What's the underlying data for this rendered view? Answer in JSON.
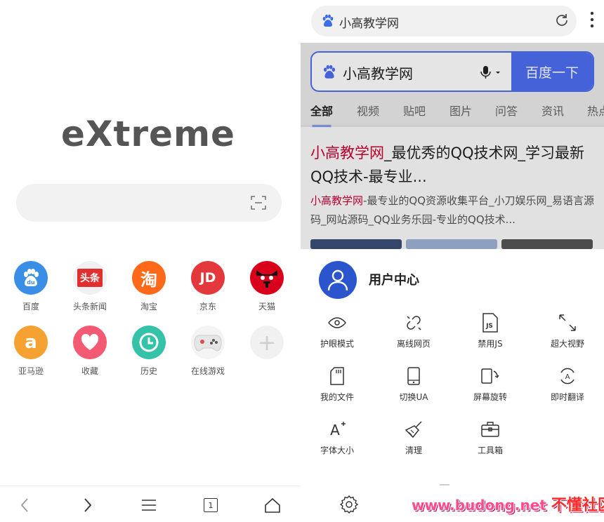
{
  "home": {
    "logo": "eXtreme",
    "shortcuts": [
      {
        "label": "百度",
        "icon": "baidu-paw-icon",
        "glyph": "",
        "color": "#3b8ee5"
      },
      {
        "label": "头条新闻",
        "icon": "toutiao-icon",
        "glyph": "头条",
        "color": "#f0f0f0"
      },
      {
        "label": "淘宝",
        "icon": "taobao-icon",
        "glyph": "淘",
        "color": "#ff6a1a"
      },
      {
        "label": "京东",
        "icon": "jd-icon",
        "glyph": "JD",
        "color": "#e4393c"
      },
      {
        "label": "天猫",
        "icon": "tmall-icon",
        "glyph": "",
        "color": "#d8001b"
      },
      {
        "label": "亚马逊",
        "icon": "amazon-icon",
        "glyph": "a",
        "color": "#f5a233"
      },
      {
        "label": "收藏",
        "icon": "heart-icon",
        "glyph": "",
        "color": "#f25b73"
      },
      {
        "label": "历史",
        "icon": "clock-icon",
        "glyph": "",
        "color": "#34c3a8"
      },
      {
        "label": "在线游戏",
        "icon": "gamepad-icon",
        "glyph": "",
        "color": "#f2f2f2"
      },
      {
        "label": "",
        "icon": "add-icon",
        "glyph": "+",
        "color": "#f1f1f1"
      }
    ],
    "nav": {
      "tab_count": "1"
    }
  },
  "browser": {
    "url_text": "小高教学网",
    "page": {
      "query": "小高教学网",
      "search_button": "百度一下",
      "tabs": [
        "全部",
        "视频",
        "贴吧",
        "图片",
        "问答",
        "资讯",
        "热点"
      ],
      "result": {
        "title_hl": "小高教学网",
        "title_rest": "_最优秀的QQ技术网_学习最新QQ技术-最专业...",
        "desc_hl": "小高教学网",
        "desc_rest": "-最专业的QQ资源收集平台_小刀娱乐网_易语言源码_网站源码_QQ业务乐园-专业的QQ技术..."
      }
    },
    "menu": {
      "user_center": "用户中心",
      "items": [
        {
          "label": "护眼模式",
          "icon": "eye-icon"
        },
        {
          "label": "离线网页",
          "icon": "offline-link-icon"
        },
        {
          "label": "禁用JS",
          "icon": "js-file-icon"
        },
        {
          "label": "超大视野",
          "icon": "expand-icon"
        },
        {
          "label": "我的文件",
          "icon": "sd-card-icon"
        },
        {
          "label": "切换UA",
          "icon": "phone-icon"
        },
        {
          "label": "屏幕旋转",
          "icon": "rotate-screen-icon"
        },
        {
          "label": "即时翻译",
          "icon": "translate-icon"
        },
        {
          "label": "字体大小",
          "icon": "font-size-icon"
        },
        {
          "label": "清理",
          "icon": "broom-icon"
        },
        {
          "label": "工具箱",
          "icon": "toolbox-icon"
        }
      ]
    },
    "watermark": {
      "site": "www.budong.net",
      "name": "不懂社区"
    }
  }
}
